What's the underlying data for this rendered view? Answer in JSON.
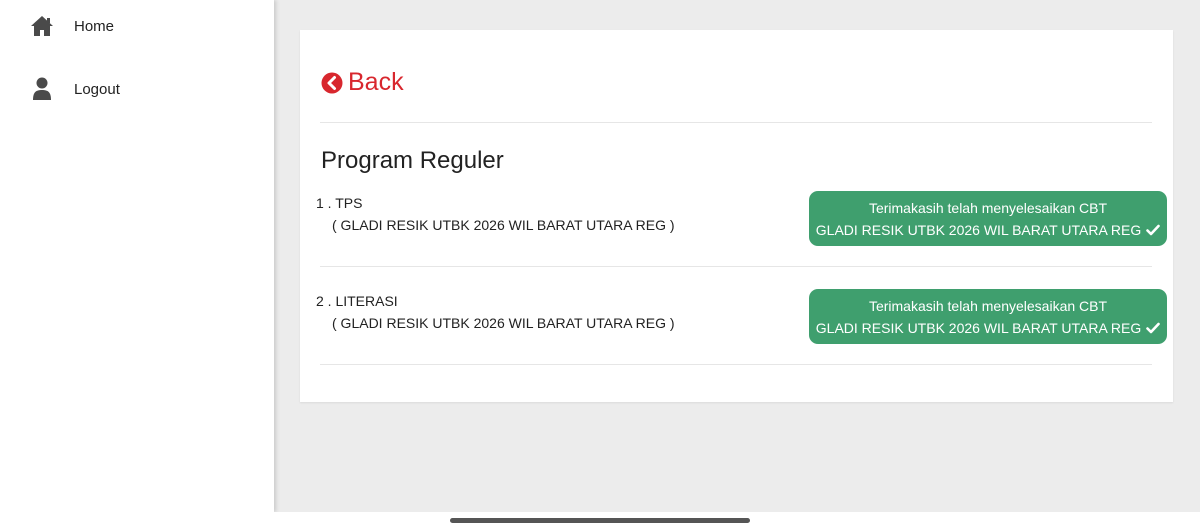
{
  "sidebar": {
    "items": [
      {
        "label": "Home",
        "icon": "home-icon"
      },
      {
        "label": "Logout",
        "icon": "user-icon"
      }
    ]
  },
  "main": {
    "back_label": "Back",
    "section_title": "Program Reguler",
    "exams": [
      {
        "name": "1 . TPS",
        "session": "( GLADI RESIK UTBK 2026 WIL BARAT UTARA REG )",
        "status_line1": "Terimakasih telah menyelesaikan CBT",
        "status_line2": "GLADI RESIK UTBK 2026 WIL BARAT UTARA REG"
      },
      {
        "name": "2 . LITERASI",
        "session": "( GLADI RESIK UTBK 2026 WIL BARAT UTARA REG )",
        "status_line1": "Terimakasih telah menyelesaikan CBT",
        "status_line2": "GLADI RESIK UTBK 2026 WIL BARAT UTARA REG"
      }
    ]
  },
  "colors": {
    "accent_red": "#d8272e",
    "success_green": "#3f9f6e",
    "background": "#ececec"
  }
}
